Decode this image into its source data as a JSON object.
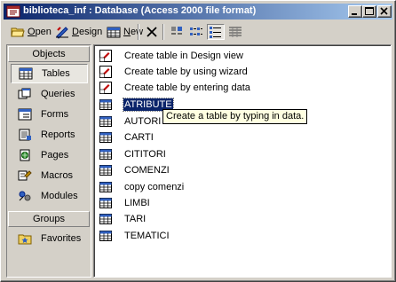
{
  "window": {
    "title": "biblioteca_inf : Database (Access 2000 file format)",
    "controls": [
      "minimize",
      "maximize",
      "close"
    ]
  },
  "toolbar": {
    "open_label": "Open",
    "design_label": "Design",
    "new_label": "New",
    "delete_icon": "delete-x-icon",
    "views": [
      "large-icons-icon",
      "small-icons-icon",
      "list-view-icon",
      "details-view-icon"
    ],
    "active_view": "list-view-icon"
  },
  "sidebar": {
    "objects_header": "Objects",
    "groups_header": "Groups",
    "items": [
      {
        "label": "Tables",
        "icon": "table-icon",
        "selected": true
      },
      {
        "label": "Queries",
        "icon": "query-icon"
      },
      {
        "label": "Forms",
        "icon": "form-icon"
      },
      {
        "label": "Reports",
        "icon": "report-icon"
      },
      {
        "label": "Pages",
        "icon": "page-icon"
      },
      {
        "label": "Macros",
        "icon": "macro-icon"
      },
      {
        "label": "Modules",
        "icon": "module-icon"
      }
    ],
    "groups": [
      {
        "label": "Favorites",
        "icon": "favorites-icon"
      }
    ]
  },
  "list": {
    "shortcuts": [
      "Create table in Design view",
      "Create table by using wizard",
      "Create table by entering data"
    ],
    "tables": [
      "ATRIBUTE",
      "AUTORI",
      "CARTI",
      "CITITORI",
      "COMENZI",
      "copy comenzi",
      "LIMBI",
      "TARI",
      "TEMATICI"
    ],
    "selected": "ATRIBUTE"
  },
  "tooltip": "Create a table by typing in data.",
  "colors": {
    "titlebar_start": "#0a246a",
    "titlebar_end": "#a6caf0",
    "selection": "#0a246a",
    "tooltip_bg": "#ffffe1",
    "face": "#d4d0c8"
  }
}
